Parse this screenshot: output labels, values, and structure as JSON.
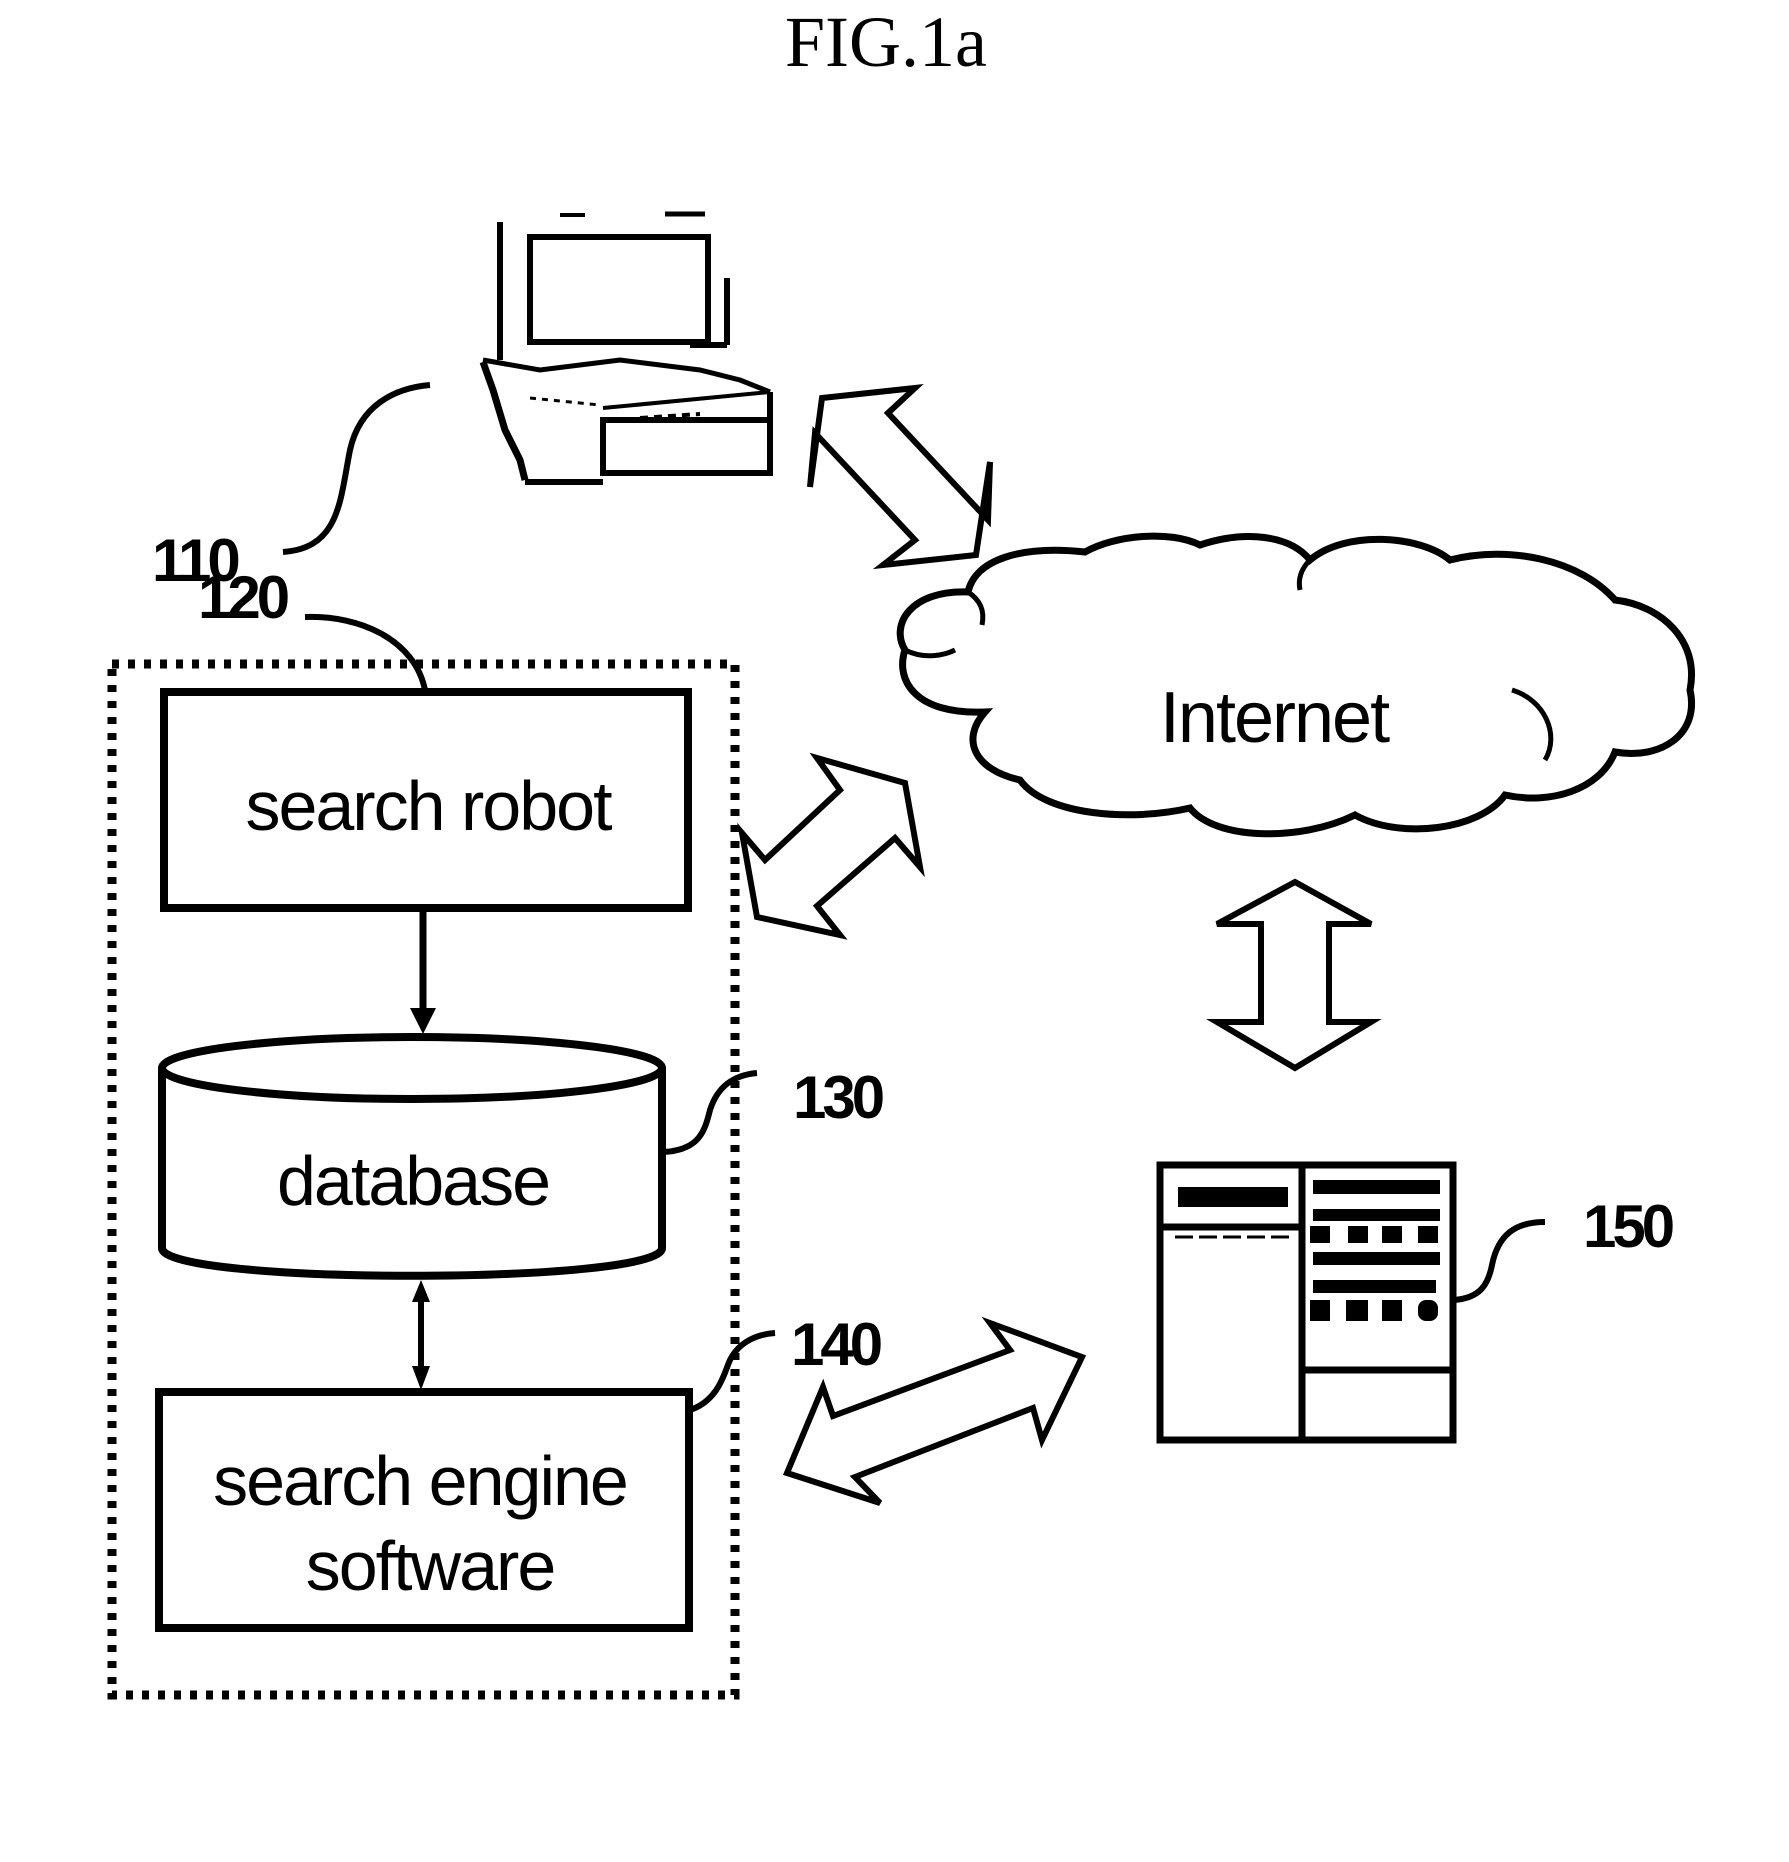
{
  "figure": {
    "title": "FIG.1a",
    "colors": {
      "ink": "#000000",
      "paper": "#ffffff"
    }
  },
  "nodes": {
    "client": {
      "ref": "110",
      "icon": "laptop-computer-icon"
    },
    "system": {
      "ref": "120",
      "boundary": "dotted"
    },
    "search_robot": {
      "label": "search robot"
    },
    "database": {
      "ref": "130",
      "label": "database",
      "icon": "database-cylinder-icon"
    },
    "search_engine": {
      "ref": "140",
      "label_line1": "search engine",
      "label_line2": "software"
    },
    "internet": {
      "label": "Internet",
      "icon": "cloud-icon"
    },
    "server": {
      "ref": "150",
      "icon": "web-page-window-icon"
    }
  },
  "connections": [
    {
      "from": "client",
      "to": "internet",
      "type": "double-arrow"
    },
    {
      "from": "system",
      "to": "internet",
      "type": "double-arrow"
    },
    {
      "from": "internet",
      "to": "server",
      "type": "double-arrow"
    },
    {
      "from": "search_engine",
      "to": "server",
      "type": "double-arrow"
    },
    {
      "from": "search_robot",
      "to": "database",
      "type": "arrow"
    },
    {
      "from": "database",
      "to": "search_engine",
      "type": "double-arrow"
    }
  ]
}
